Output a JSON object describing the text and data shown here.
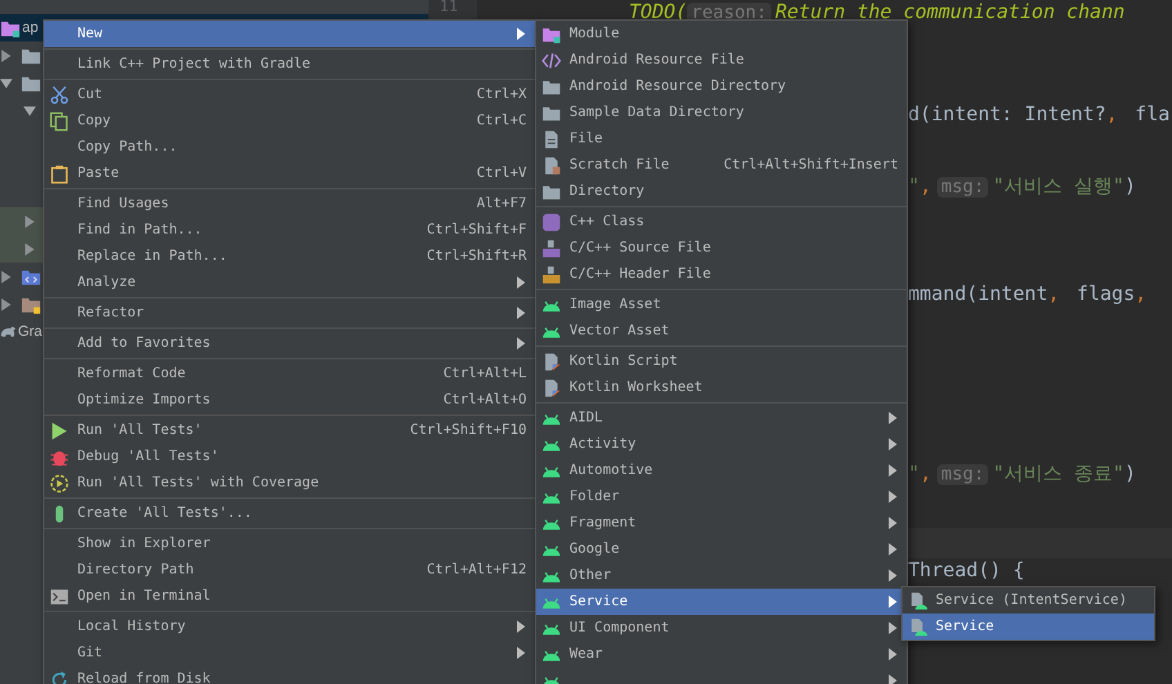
{
  "project_tree": [
    {
      "kind": "module",
      "label": "ap",
      "selected": true,
      "highlighted": false
    },
    {
      "kind": "folder",
      "expanded": false,
      "selected": false,
      "highlighted": false
    },
    {
      "kind": "folder",
      "expanded": true,
      "selected": false,
      "highlighted": false
    },
    {
      "kind": "plain",
      "expanded": true,
      "selected": false,
      "highlighted": false
    },
    {
      "kind": "plain",
      "expanded": false,
      "selected": false,
      "highlighted": true
    },
    {
      "kind": "plain",
      "expanded": false,
      "selected": false,
      "highlighted": true
    },
    {
      "kind": "xml-folder",
      "expanded": false,
      "selected": false,
      "highlighted": false
    },
    {
      "kind": "res-folder",
      "expanded": false,
      "selected": false,
      "highlighted": false
    },
    {
      "kind": "gradle",
      "label": "Gra",
      "selected": false,
      "highlighted": false
    }
  ],
  "editor": {
    "line_number": "11",
    "code_lines": [
      {
        "tokens": [
          {
            "kind": "todo",
            "text": "TODO("
          },
          {
            "kind": "hint",
            "text": "reason:"
          },
          {
            "kind": "todo",
            "text": "Return the communication chann"
          }
        ]
      },
      {
        "tokens": [
          {
            "kind": "plain",
            "text": "d(intent: Intent?"
          },
          {
            "kind": "punct",
            "text": ","
          },
          {
            "kind": "plain",
            "text": " fla"
          }
        ]
      },
      {
        "tokens": [
          {
            "kind": "string",
            "text": "\""
          },
          {
            "kind": "punct",
            "text": ","
          },
          {
            "kind": "hint",
            "text": "msg:"
          },
          {
            "kind": "string",
            "text": "\"서비스 실행\""
          },
          {
            "kind": "plain",
            "text": ")"
          }
        ]
      },
      {
        "tokens": [
          {
            "kind": "plain",
            "text": "mmand(intent"
          },
          {
            "kind": "punct",
            "text": ","
          },
          {
            "kind": "plain",
            "text": " flags"
          },
          {
            "kind": "punct",
            "text": ","
          }
        ]
      },
      {
        "tokens": [
          {
            "kind": "string",
            "text": "\""
          },
          {
            "kind": "punct",
            "text": ","
          },
          {
            "kind": "hint",
            "text": "msg:"
          },
          {
            "kind": "string",
            "text": "\"서비스 종료\""
          },
          {
            "kind": "plain",
            "text": ")"
          }
        ]
      },
      {
        "tokens": [
          {
            "kind": "plain",
            "text": "Thread() {"
          }
        ]
      }
    ]
  },
  "context_menu": {
    "items": [
      {
        "kind": "plain",
        "label": "New",
        "submenu": true,
        "selected": true
      },
      {
        "kind": "separator"
      },
      {
        "kind": "plain",
        "label": "Link C++ Project with Gradle",
        "selected": false
      },
      {
        "kind": "separator"
      },
      {
        "kind": "cut",
        "label": "Cut",
        "shortcut": "Ctrl+X",
        "selected": false
      },
      {
        "kind": "copy",
        "label": "Copy",
        "shortcut": "Ctrl+C",
        "selected": false
      },
      {
        "kind": "plain",
        "label": "Copy Path...",
        "selected": false
      },
      {
        "kind": "paste",
        "label": "Paste",
        "shortcut": "Ctrl+V",
        "selected": false
      },
      {
        "kind": "separator"
      },
      {
        "kind": "plain",
        "label": "Find Usages",
        "shortcut": "Alt+F7",
        "selected": false
      },
      {
        "kind": "plain",
        "label": "Find in Path...",
        "shortcut": "Ctrl+Shift+F",
        "selected": false
      },
      {
        "kind": "plain",
        "label": "Replace in Path...",
        "shortcut": "Ctrl+Shift+R",
        "selected": false
      },
      {
        "kind": "plain",
        "label": "Analyze",
        "submenu": true,
        "selected": false
      },
      {
        "kind": "separator"
      },
      {
        "kind": "plain",
        "label": "Refactor",
        "submenu": true,
        "selected": false
      },
      {
        "kind": "separator"
      },
      {
        "kind": "plain",
        "label": "Add to Favorites",
        "submenu": true,
        "selected": false
      },
      {
        "kind": "separator"
      },
      {
        "kind": "plain",
        "label": "Reformat Code",
        "shortcut": "Ctrl+Alt+L",
        "selected": false
      },
      {
        "kind": "plain",
        "label": "Optimize Imports",
        "shortcut": "Ctrl+Alt+O",
        "selected": false
      },
      {
        "kind": "separator"
      },
      {
        "kind": "run",
        "label": "Run 'All Tests'",
        "shortcut": "Ctrl+Shift+F10",
        "selected": false
      },
      {
        "kind": "debug",
        "label": "Debug 'All Tests'",
        "selected": false
      },
      {
        "kind": "coverage",
        "label": "Run 'All Tests' with Coverage",
        "selected": false
      },
      {
        "kind": "separator"
      },
      {
        "kind": "test",
        "label": "Create 'All Tests'...",
        "selected": false
      },
      {
        "kind": "separator"
      },
      {
        "kind": "plain",
        "label": "Show in Explorer",
        "selected": false
      },
      {
        "kind": "plain",
        "label": "Directory Path",
        "shortcut": "Ctrl+Alt+F12",
        "selected": false
      },
      {
        "kind": "terminal",
        "label": "Open in Terminal",
        "selected": false
      },
      {
        "kind": "separator"
      },
      {
        "kind": "plain",
        "label": "Local History",
        "submenu": true,
        "selected": false
      },
      {
        "kind": "plain",
        "label": "Git",
        "submenu": true,
        "selected": false
      },
      {
        "kind": "reload",
        "label": "Reload from Disk",
        "selected": false
      }
    ]
  },
  "new_submenu": {
    "items": [
      {
        "kind": "module",
        "label": "Module",
        "selected": false
      },
      {
        "kind": "xml",
        "label": "Android Resource File",
        "selected": false
      },
      {
        "kind": "folder",
        "label": "Android Resource Directory",
        "selected": false
      },
      {
        "kind": "folder",
        "label": "Sample Data Directory",
        "selected": false
      },
      {
        "kind": "file",
        "label": "File",
        "selected": false
      },
      {
        "kind": "scratch",
        "label": "Scratch File",
        "shortcut": "Ctrl+Alt+Shift+Insert",
        "selected": false
      },
      {
        "kind": "folder",
        "label": "Directory",
        "selected": false
      },
      {
        "kind": "separator"
      },
      {
        "kind": "cpp-class",
        "label": "C++ Class",
        "selected": false
      },
      {
        "kind": "cpp-source",
        "label": "C/C++ Source File",
        "selected": false
      },
      {
        "kind": "cpp-header",
        "label": "C/C++ Header File",
        "selected": false
      },
      {
        "kind": "separator"
      },
      {
        "kind": "android",
        "label": "Image Asset",
        "selected": false
      },
      {
        "kind": "android",
        "label": "Vector Asset",
        "selected": false
      },
      {
        "kind": "separator"
      },
      {
        "kind": "kotlin",
        "label": "Kotlin Script",
        "selected": false
      },
      {
        "kind": "kotlin",
        "label": "Kotlin Worksheet",
        "selected": false
      },
      {
        "kind": "separator"
      },
      {
        "kind": "android",
        "label": "AIDL",
        "submenu": true,
        "selected": false
      },
      {
        "kind": "android",
        "label": "Activity",
        "submenu": true,
        "selected": false
      },
      {
        "kind": "android",
        "label": "Automotive",
        "submenu": true,
        "selected": false
      },
      {
        "kind": "android",
        "label": "Folder",
        "submenu": true,
        "selected": false
      },
      {
        "kind": "android",
        "label": "Fragment",
        "submenu": true,
        "selected": false
      },
      {
        "kind": "android",
        "label": "Google",
        "submenu": true,
        "selected": false
      },
      {
        "kind": "android",
        "label": "Other",
        "submenu": true,
        "selected": false
      },
      {
        "kind": "android",
        "label": "Service",
        "submenu": true,
        "selected": true
      },
      {
        "kind": "android",
        "label": "UI Component",
        "submenu": true,
        "selected": false
      },
      {
        "kind": "android",
        "label": "Wear",
        "submenu": true,
        "selected": false
      },
      {
        "kind": "android",
        "submenu": true,
        "selected": false
      }
    ]
  },
  "service_submenu": {
    "items": [
      {
        "kind": "service-file",
        "label": "Service (IntentService)",
        "selected": false
      },
      {
        "kind": "service-file",
        "label": "Service",
        "selected": true
      }
    ]
  }
}
